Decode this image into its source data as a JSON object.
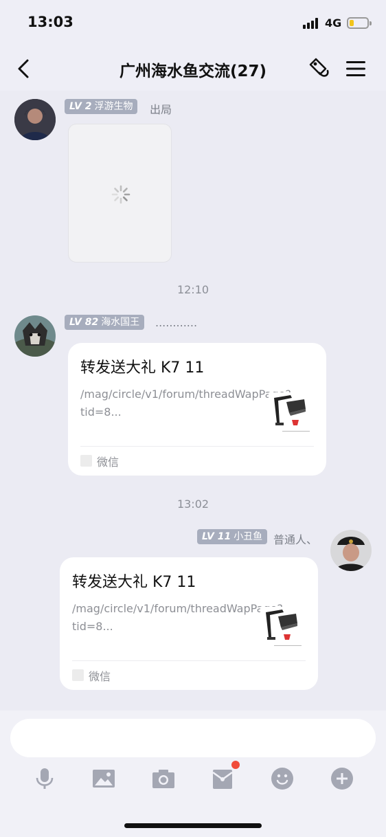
{
  "status_bar": {
    "time": "13:03",
    "network": "4G",
    "battery_level": 0.25
  },
  "nav": {
    "title": "广州海水鱼交流(27)",
    "back_icon": "chevron-left-icon",
    "tag_icon": "tag-icon",
    "menu_icon": "hamburger-menu-icon"
  },
  "messages": [
    {
      "level": "LV 2",
      "name": "浮游生物",
      "role": "出局",
      "type": "image-loading"
    },
    {
      "time": "12:10"
    },
    {
      "level": "LV 82",
      "name": "海水国王",
      "role": "............",
      "type": "link-card",
      "card": {
        "title": "转发送大礼 K7 11",
        "url": "/mag/circle/v1/forum/threadWapPage?tid=8...",
        "source": "微信"
      }
    },
    {
      "time": "13:02"
    },
    {
      "level": "LV 11",
      "name": "小丑鱼",
      "role": "普通人、",
      "type": "link-card",
      "self": true,
      "card": {
        "title": "转发送大礼 K7 11",
        "url": "/mag/circle/v1/forum/threadWapPage?tid=8...",
        "source": "微信"
      }
    }
  ],
  "input": {
    "placeholder": ""
  },
  "toolbar": [
    "microphone-icon",
    "image-icon",
    "camera-icon",
    "red-packet-icon",
    "emoji-icon",
    "plus-icon"
  ],
  "colors": {
    "badge": "#a7adbd",
    "background": "#ebebf3",
    "notification_dot": "#f04b3a",
    "battery": "#f2c41b"
  }
}
